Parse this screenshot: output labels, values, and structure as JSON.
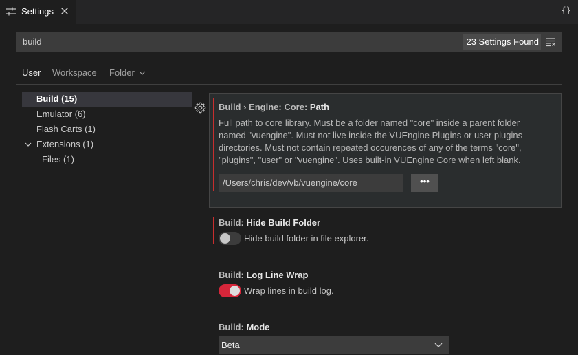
{
  "tab": {
    "title": "Settings"
  },
  "header": {
    "json_toggle": "{}"
  },
  "search": {
    "value": "build",
    "count": "23 Settings Found"
  },
  "scopes": [
    {
      "label": "User"
    },
    {
      "label": "Workspace"
    },
    {
      "label": "Folder"
    }
  ],
  "toc": {
    "items": [
      {
        "label": "Build (15)"
      },
      {
        "label": "Emulator (6)"
      },
      {
        "label": "Flash Carts (1)"
      },
      {
        "label": "Extensions (1)"
      },
      {
        "label": "Files (1)"
      }
    ]
  },
  "settings": {
    "core_path": {
      "category": "Build › Engine: Core: ",
      "name": "Path",
      "description_lines": [
        "Full path to core library. Must be a folder named \"core\" inside a parent folder",
        "named \"vuengine\". Must not live inside the VUEngine Plugins or user plugins",
        "directories. Must not contain repeated occurences of any of the terms \"core\",",
        "\"plugins\", \"user\" or \"vuengine\". Uses built-in VUEngine Core when left blank."
      ],
      "value": "/Users/chris/dev/vb/vuengine/core",
      "browse_label": "•••"
    },
    "hide_build_folder": {
      "category": "Build: ",
      "name": "Hide Build Folder",
      "label": "Hide build folder in file explorer.",
      "enabled": false
    },
    "log_line_wrap": {
      "category": "Build: ",
      "name": "Log Line Wrap",
      "label": "Wrap lines in build log.",
      "enabled": true
    },
    "mode": {
      "category": "Build: ",
      "name": "Mode",
      "value": "Beta"
    }
  },
  "colors": {
    "accent_modified": "#c72e2e",
    "toggle_on": "#d6263a",
    "background": "#1e1e1e"
  }
}
